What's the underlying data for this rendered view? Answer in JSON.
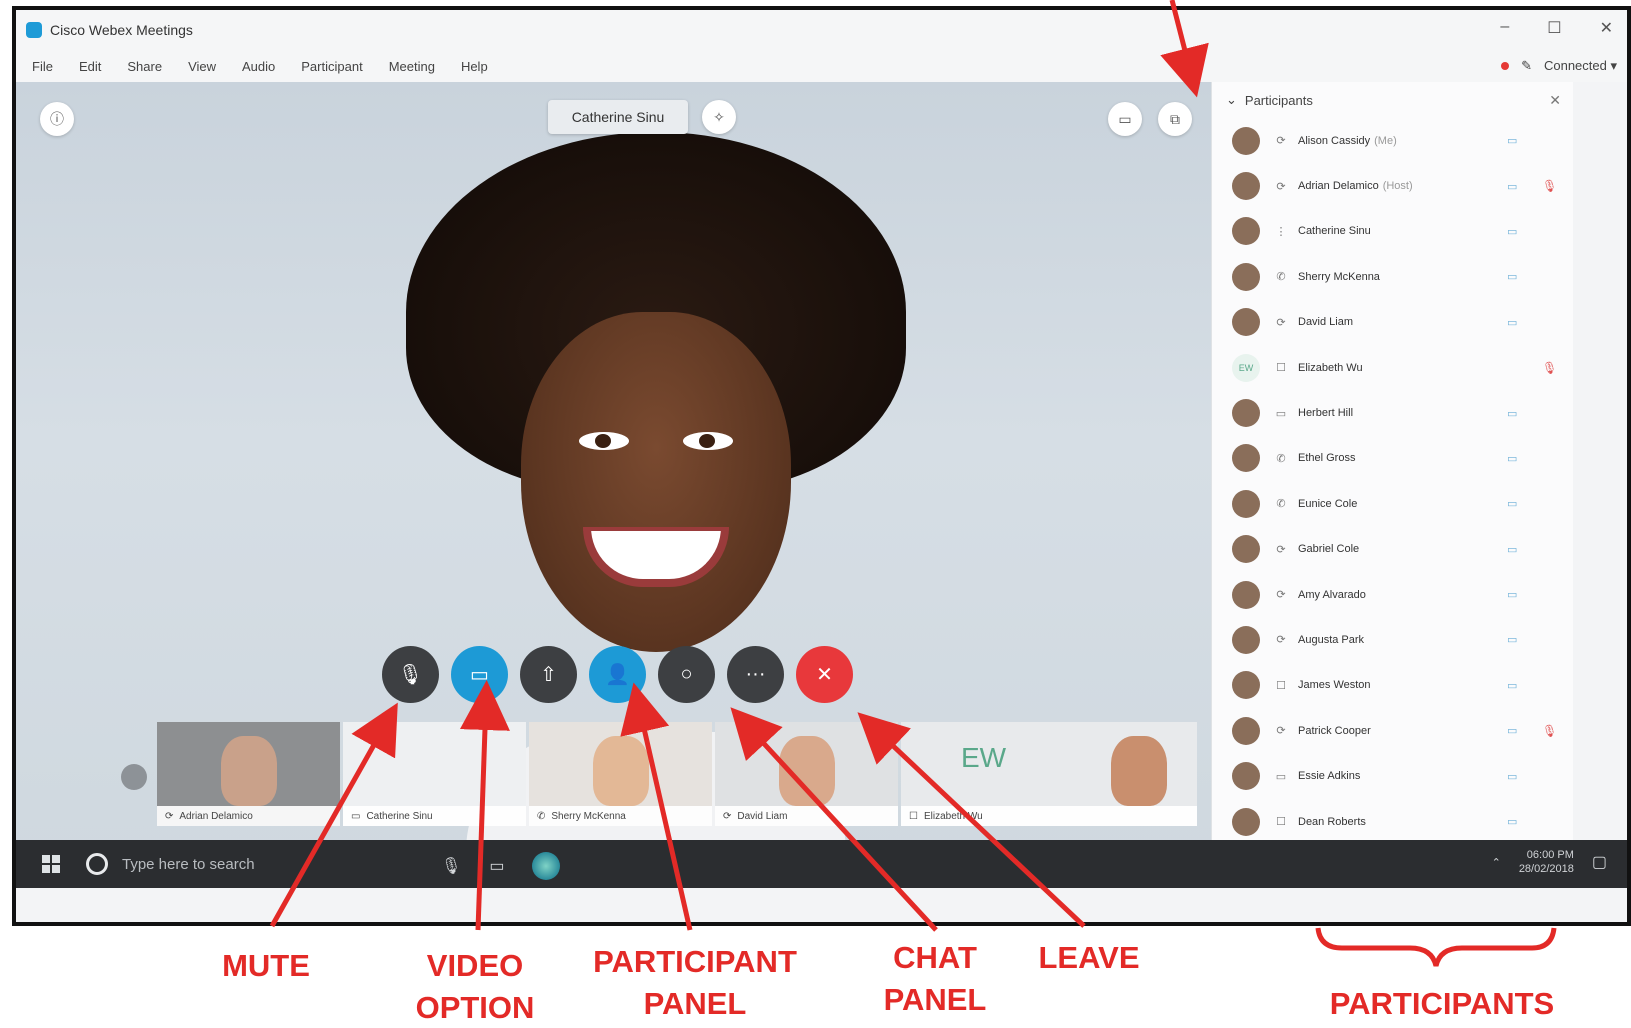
{
  "window": {
    "title": "Cisco Webex Meetings",
    "controls": [
      "–",
      "☐",
      "✕"
    ]
  },
  "menu": {
    "items": [
      "File",
      "Edit",
      "Share",
      "View",
      "Audio",
      "Participant",
      "Meeting",
      "Help"
    ],
    "connection": "Connected ▾"
  },
  "stage": {
    "speaker_name": "Catherine Sinu"
  },
  "controls": {
    "mute": "🎙",
    "video": "▭",
    "share": "⇧",
    "participants": "👤",
    "chat": "○",
    "more": "···",
    "leave": "✕"
  },
  "thumbnails": [
    {
      "name": "Adrian Delamico",
      "status_icon": "⟳"
    },
    {
      "name": "Catherine Sinu",
      "status_icon": "▭"
    },
    {
      "name": "Sherry McKenna",
      "status_icon": "✆"
    },
    {
      "name": "David Liam",
      "status_icon": "⟳"
    },
    {
      "name": "Elizabeth Wu",
      "status_icon": "☐",
      "initials": "EW"
    }
  ],
  "taskbar": {
    "search_placeholder": "Type here to search",
    "time": "06:00 PM",
    "date": "28/02/2018"
  },
  "participants_panel": {
    "title": "Participants",
    "rows": [
      {
        "name": "Alison Cassidy",
        "tag": "(Me)",
        "status": "⟳",
        "cam": true,
        "mic_muted": false
      },
      {
        "name": "Adrian Delamico",
        "tag": "(Host)",
        "status": "⟳",
        "cam": true,
        "mic_muted": true
      },
      {
        "name": "Catherine Sinu",
        "tag": "",
        "status": "⋮",
        "cam": true,
        "mic_muted": false
      },
      {
        "name": "Sherry McKenna",
        "tag": "",
        "status": "✆",
        "cam": true,
        "mic_muted": false
      },
      {
        "name": "David Liam",
        "tag": "",
        "status": "⟳",
        "cam": true,
        "mic_muted": false
      },
      {
        "name": "Elizabeth Wu",
        "tag": "",
        "status": "☐",
        "cam": false,
        "mic_muted": true,
        "initials": "EW"
      },
      {
        "name": "Herbert Hill",
        "tag": "",
        "status": "▭",
        "cam": true,
        "mic_muted": false
      },
      {
        "name": "Ethel Gross",
        "tag": "",
        "status": "✆",
        "cam": true,
        "mic_muted": false
      },
      {
        "name": "Eunice Cole",
        "tag": "",
        "status": "✆",
        "cam": true,
        "mic_muted": false
      },
      {
        "name": "Gabriel Cole",
        "tag": "",
        "status": "⟳",
        "cam": true,
        "mic_muted": false
      },
      {
        "name": "Amy Alvarado",
        "tag": "",
        "status": "⟳",
        "cam": true,
        "mic_muted": false
      },
      {
        "name": "Augusta Park",
        "tag": "",
        "status": "⟳",
        "cam": true,
        "mic_muted": false
      },
      {
        "name": "James Weston",
        "tag": "",
        "status": "☐",
        "cam": true,
        "mic_muted": false
      },
      {
        "name": "Patrick Cooper",
        "tag": "",
        "status": "⟳",
        "cam": true,
        "mic_muted": true
      },
      {
        "name": "Essie Adkins",
        "tag": "",
        "status": "▭",
        "cam": true,
        "mic_muted": false
      },
      {
        "name": "Dean Roberts",
        "tag": "",
        "status": "☐",
        "cam": true,
        "mic_muted": false
      }
    ]
  },
  "annotations": {
    "mute": "MUTE",
    "video_1": "VIDEO",
    "video_2": "OPTION",
    "participant_1": "PARTICIPANT",
    "participant_2": "PANEL",
    "chat_1": "CHAT",
    "chat_2": "PANEL",
    "leave": "LEAVE",
    "participants": "PARTICIPANTS"
  },
  "colors": {
    "annotation_red": "#e32a27",
    "webex_blue": "#1d9ad6",
    "leave_red": "#e8383b"
  }
}
